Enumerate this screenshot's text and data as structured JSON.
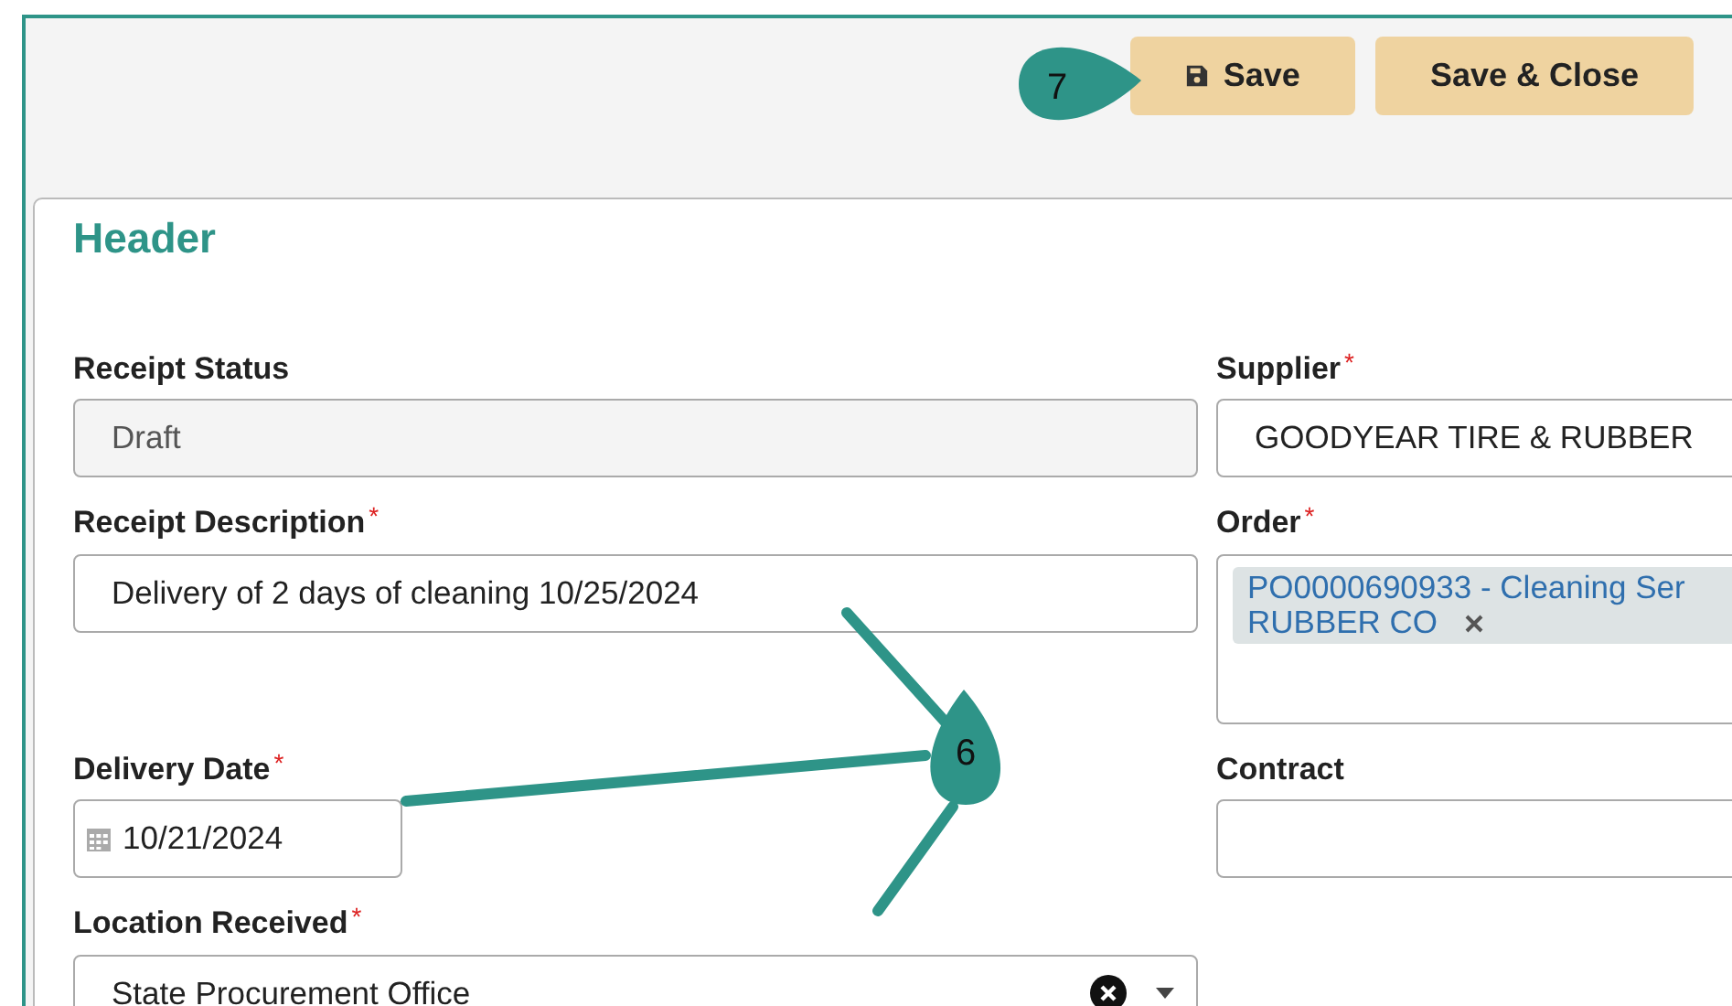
{
  "toolbar": {
    "buttons": [
      {
        "label": "Save",
        "kind": "save"
      },
      {
        "label": "Save & Close",
        "kind": "plain"
      }
    ]
  },
  "section": {
    "title": "Header"
  },
  "fields": [
    {
      "label": "Receipt Status",
      "kind": "text",
      "value": "Draft",
      "disabled": true
    },
    {
      "label": "Supplier",
      "marker": "*",
      "kind": "text",
      "value": "GOODYEAR TIRE & RUBBER"
    },
    {
      "label": "Receipt Description",
      "marker": "*",
      "kind": "text",
      "value": "Delivery of 2 days of cleaning 10/25/2024"
    },
    {
      "label": "Order",
      "marker": "*",
      "kind": "chips",
      "chips": [
        {
          "lines": [
            "PO0000690933 - Cleaning Ser",
            "RUBBER CO"
          ]
        }
      ]
    },
    {
      "label": "Delivery Date",
      "marker": "*",
      "kind": "date",
      "value": "10/21/2024"
    },
    {
      "label": "Contract",
      "kind": "text"
    },
    {
      "label": "Location Received",
      "marker": "*",
      "kind": "select",
      "value": "State Procurement Office"
    }
  ],
  "annotations": [
    {
      "label": "7"
    },
    {
      "label": "6"
    }
  ]
}
